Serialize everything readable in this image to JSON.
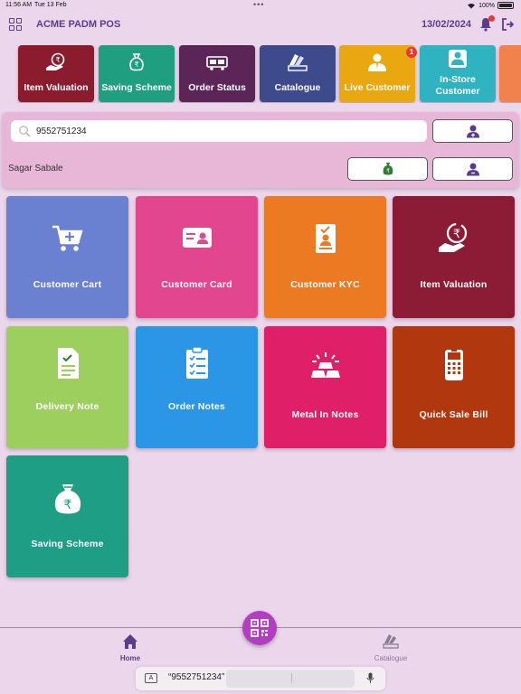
{
  "status": {
    "time": "11:56 AM",
    "date": "Tue 13 Feb",
    "dots": "•••",
    "battery": "100%"
  },
  "appbar": {
    "title": "ACME PADM POS",
    "date": "13/02/2024"
  },
  "quick_tiles": [
    {
      "label": "Item Valuation",
      "icon": "hand-rupee-icon",
      "color": "#8a1c2e"
    },
    {
      "label": "Saving Scheme",
      "icon": "money-bag-icon",
      "color": "#1f9e80"
    },
    {
      "label": "Order Status",
      "icon": "truck-icon",
      "color": "#5b2557"
    },
    {
      "label": "Catalogue",
      "icon": "catalogue-icon",
      "color": "#3d4a8b"
    },
    {
      "label": "Live Customer",
      "icon": "customer-icon",
      "color": "#e9a810",
      "badge": "1"
    },
    {
      "label": "In-Store Customer",
      "icon": "instore-customer-icon",
      "color": "#2fb3c0"
    }
  ],
  "search": {
    "value": "9552751234",
    "placeholder": ""
  },
  "customer": {
    "name": "Sagar Sabale"
  },
  "tiles": [
    {
      "label": "Customer Cart",
      "icon": "cart-icon",
      "color": "#6a80d0"
    },
    {
      "label": "Customer Card",
      "icon": "id-card-icon",
      "color": "#e2468e"
    },
    {
      "label": "Customer KYC",
      "icon": "kyc-icon",
      "color": "#ec7a22"
    },
    {
      "label": "Item Valuation",
      "icon": "hand-rupee-icon",
      "color": "#8c1c36"
    },
    {
      "label": "Delivery Note",
      "icon": "document-icon",
      "color": "#9ccf5e"
    },
    {
      "label": "Order Notes",
      "icon": "clipboard-icon",
      "color": "#2b96e6"
    },
    {
      "label": "Metal In Notes",
      "icon": "gold-bars-icon",
      "color": "#df1f68"
    },
    {
      "label": "Quick Sale Bill",
      "icon": "card-terminal-icon",
      "color": "#b1370e"
    },
    {
      "label": "Saving Scheme",
      "icon": "money-bag-icon",
      "color": "#1e9e84"
    }
  ],
  "nav": {
    "home": "Home",
    "catalogue": "Catalogue"
  },
  "keyboard": {
    "suggestion": "“9552751234”"
  },
  "colors": {
    "accent": "#5a3c8c",
    "fab": "#b23ec1",
    "panel": "#e8b6d7",
    "background": "#ecd6ec"
  }
}
